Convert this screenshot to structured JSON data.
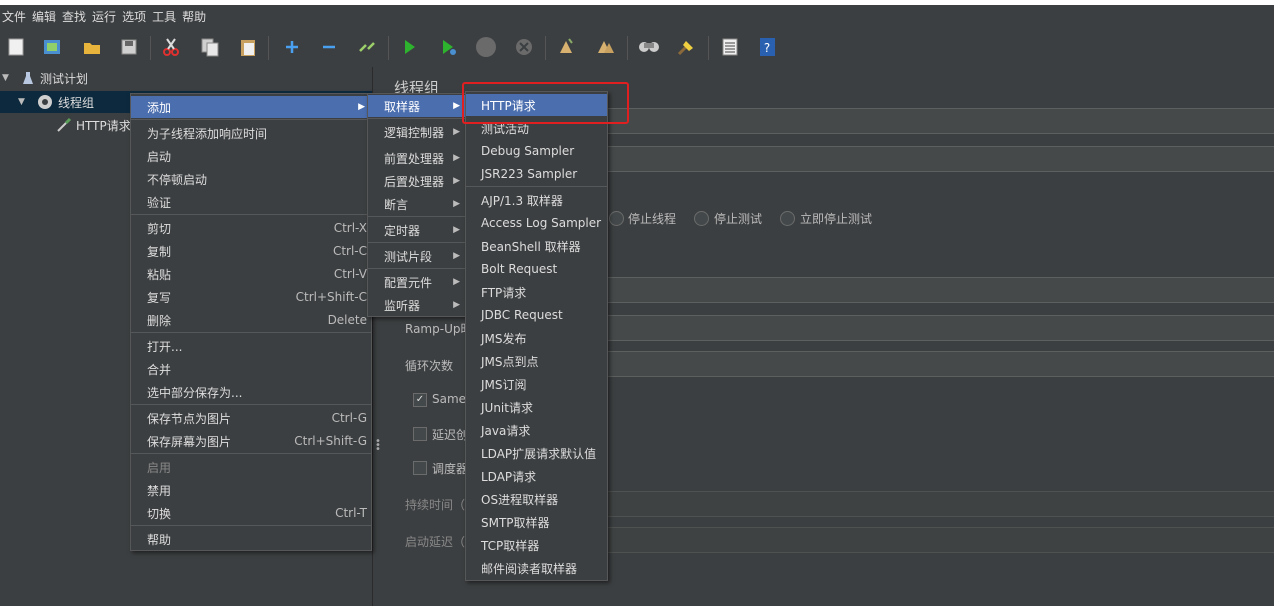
{
  "menubar": [
    "文件",
    "编辑",
    "查找",
    "运行",
    "选项",
    "工具",
    "帮助"
  ],
  "toolbar_icons": [
    "new-icon",
    "templates-icon",
    "open-icon",
    "save-icon",
    "cut-icon",
    "copy-icon",
    "paste-icon",
    "expand-icon",
    "collapse-icon",
    "toggle-icon",
    "start-icon",
    "start-no-pause-icon",
    "stop-icon",
    "shutdown-icon",
    "clear-icon",
    "clear-all-icon",
    "search-icon",
    "reset-search-icon",
    "function-helper-icon",
    "help-icon"
  ],
  "tree": {
    "test_plan": "测试计划",
    "thread_group": "线程组",
    "http_request": "HTTP请求"
  },
  "right_panel": {
    "title": "线程组",
    "radio_stop_thread": "停止线程",
    "radio_stop_test": "停止测试",
    "radio_stop_now": "立即停止测试",
    "ramp_up_label": "Ramp-Up时",
    "loop_label": "循环次数",
    "same_label": "Same",
    "delay_label": "延迟创",
    "scheduler_label": "调度器",
    "duration_label": "持续时间（",
    "startup_delay_label": "启动延迟（"
  },
  "context_menu": [
    {
      "label": "添加",
      "submenu": true,
      "highlight": true
    },
    {
      "label": "为子线程添加响应时间"
    },
    {
      "label": "启动"
    },
    {
      "label": "不停顿启动"
    },
    {
      "label": "验证"
    },
    {
      "label": "剪切",
      "shortcut": "Ctrl-X"
    },
    {
      "label": "复制",
      "shortcut": "Ctrl-C"
    },
    {
      "label": "粘贴",
      "shortcut": "Ctrl-V"
    },
    {
      "label": "复写",
      "shortcut": "Ctrl+Shift-C"
    },
    {
      "label": "删除",
      "shortcut": "Delete"
    },
    {
      "label": "打开..."
    },
    {
      "label": "合并"
    },
    {
      "label": "选中部分保存为..."
    },
    {
      "label": "保存节点为图片",
      "shortcut": "Ctrl-G"
    },
    {
      "label": "保存屏幕为图片",
      "shortcut": "Ctrl+Shift-G"
    },
    {
      "label": "启用",
      "disabled": true
    },
    {
      "label": "禁用"
    },
    {
      "label": "切换",
      "shortcut": "Ctrl-T"
    },
    {
      "label": "帮助"
    }
  ],
  "add_submenu": [
    {
      "label": "取样器",
      "highlight": true
    },
    {
      "label": "逻辑控制器"
    },
    {
      "label": "前置处理器"
    },
    {
      "label": "后置处理器"
    },
    {
      "label": "断言"
    },
    {
      "label": "定时器"
    },
    {
      "label": "测试片段"
    },
    {
      "label": "配置元件"
    },
    {
      "label": "监听器"
    }
  ],
  "sampler_submenu": [
    {
      "label": "HTTP请求",
      "highlight": true
    },
    {
      "label": "测试活动"
    },
    {
      "label": "Debug Sampler"
    },
    {
      "label": "JSR223 Sampler"
    },
    {
      "label": "AJP/1.3 取样器"
    },
    {
      "label": "Access Log Sampler"
    },
    {
      "label": "BeanShell 取样器"
    },
    {
      "label": "Bolt Request"
    },
    {
      "label": "FTP请求"
    },
    {
      "label": "JDBC Request"
    },
    {
      "label": "JMS发布"
    },
    {
      "label": "JMS点到点"
    },
    {
      "label": "JMS订阅"
    },
    {
      "label": "JUnit请求"
    },
    {
      "label": "Java请求"
    },
    {
      "label": "LDAP扩展请求默认值"
    },
    {
      "label": "LDAP请求"
    },
    {
      "label": "OS进程取样器"
    },
    {
      "label": "SMTP取样器"
    },
    {
      "label": "TCP取样器"
    },
    {
      "label": "邮件阅读者取样器"
    }
  ],
  "colors": {
    "highlight": "#4b6eaf",
    "annotation_box": "#e02020",
    "background": "#3c3f41"
  }
}
